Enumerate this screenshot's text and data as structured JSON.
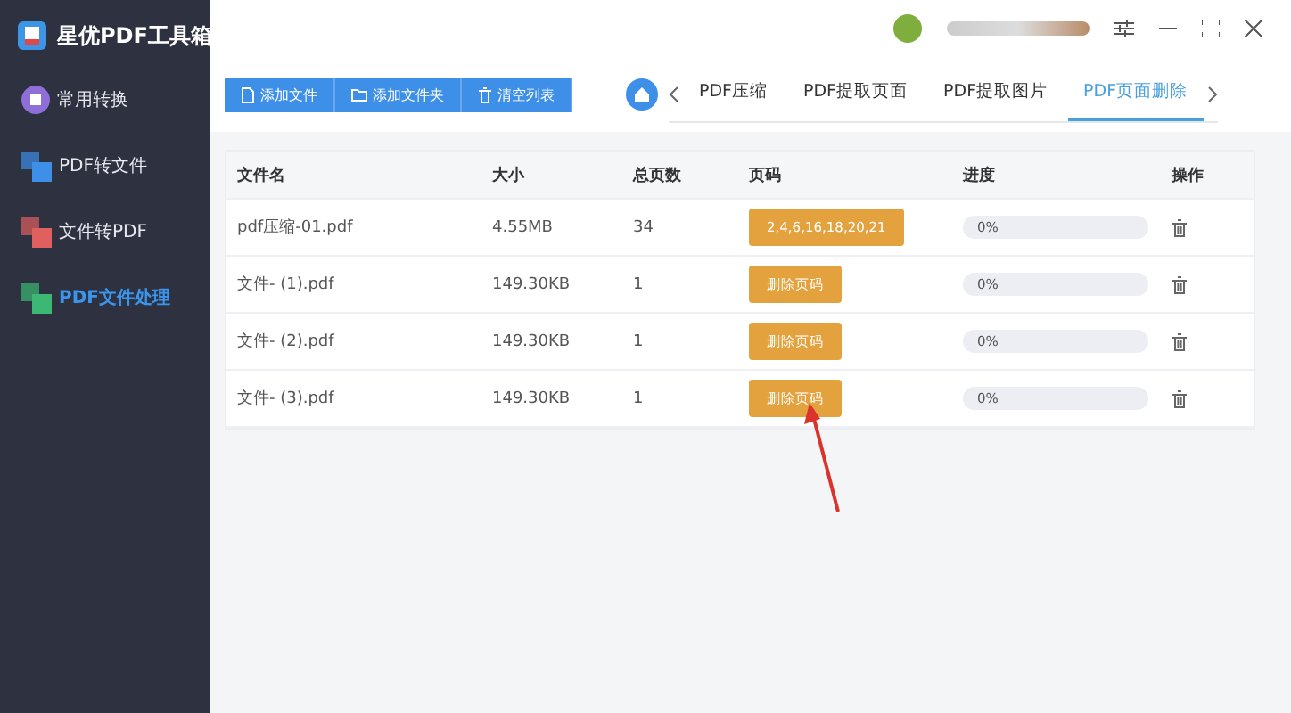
{
  "app": {
    "title": "星优PDF工具箱"
  },
  "sidebar": {
    "items": [
      {
        "label": "常用转换",
        "selected": false,
        "kind": "convert"
      },
      {
        "label": "PDF转文件",
        "selected": false,
        "kind": "pdf-to-file"
      },
      {
        "label": "文件转PDF",
        "selected": false,
        "kind": "file-to-pdf"
      },
      {
        "label": "PDF文件处理",
        "selected": true,
        "kind": "pdf-process"
      }
    ]
  },
  "toolbar": {
    "buttons": [
      {
        "label": "添加文件",
        "kind": "file"
      },
      {
        "label": "添加文件夹",
        "kind": "folder"
      },
      {
        "label": "清空列表",
        "kind": "trash"
      }
    ]
  },
  "tabs": [
    {
      "label": "PDF压缩",
      "selected": false
    },
    {
      "label": "PDF提取页面",
      "selected": false
    },
    {
      "label": "PDF提取图片",
      "selected": false
    },
    {
      "label": "PDF页面删除",
      "selected": true
    }
  ],
  "table": {
    "columns": [
      "文件名",
      "大小",
      "总页数",
      "页码",
      "进度",
      "操作"
    ],
    "rows": [
      {
        "name": "pdf压缩-01.pdf",
        "size": "4.55MB",
        "pages": "34",
        "page_code": "2,4,6,16,18,20,21",
        "progress": "0%",
        "level": 0
      },
      {
        "name": "文件- (1).pdf",
        "size": "149.30KB",
        "pages": "1",
        "page_code": "删除页码",
        "progress": "0%",
        "level": 0
      },
      {
        "name": "文件- (2).pdf",
        "size": "149.30KB",
        "pages": "1",
        "page_code": "删除页码",
        "progress": "0%",
        "level": 0
      },
      {
        "name": "文件- (3).pdf",
        "size": "149.30KB",
        "pages": "1",
        "page_code": "删除页码",
        "progress": "0%",
        "level": 0
      }
    ]
  }
}
